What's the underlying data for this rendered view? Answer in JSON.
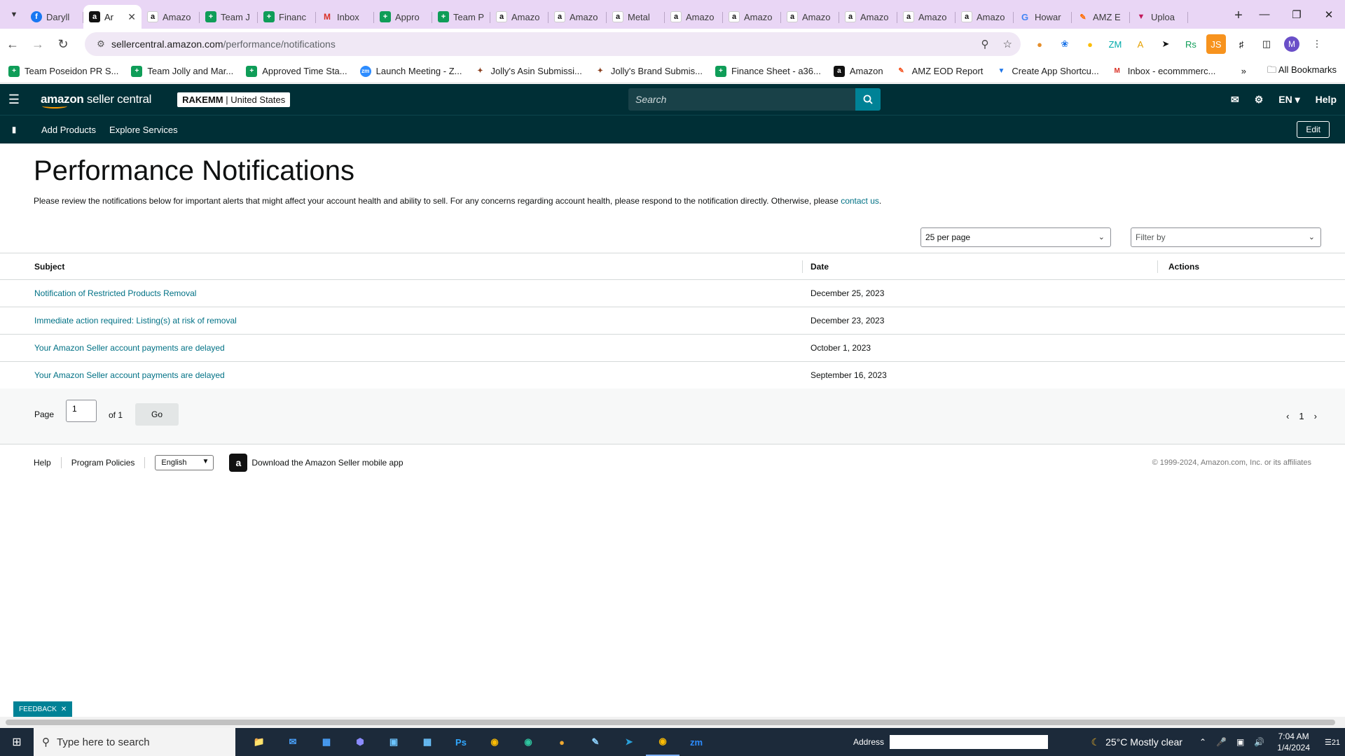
{
  "browser": {
    "tabs": [
      {
        "label": "Daryll",
        "icon": "facebook-icon"
      },
      {
        "label": "Ar",
        "icon": "amazon-icon",
        "active": true
      },
      {
        "label": "Amazo",
        "icon": "amazon-icon"
      },
      {
        "label": "Team J",
        "icon": "sheets-icon"
      },
      {
        "label": "Financ",
        "icon": "sheets-icon"
      },
      {
        "label": "Inbox",
        "icon": "gmail-icon"
      },
      {
        "label": "Appro",
        "icon": "sheets-icon"
      },
      {
        "label": "Team P",
        "icon": "sheets-icon"
      },
      {
        "label": "Amazo",
        "icon": "amazon-icon"
      },
      {
        "label": "Amazo",
        "icon": "amazon-icon"
      },
      {
        "label": "Metal",
        "icon": "amazon-icon"
      },
      {
        "label": "Amazo",
        "icon": "amazon-icon"
      },
      {
        "label": "Amazo",
        "icon": "amazon-icon"
      },
      {
        "label": "Amazo",
        "icon": "amazon-icon"
      },
      {
        "label": "Amazo",
        "icon": "amazon-icon"
      },
      {
        "label": "Amazo",
        "icon": "amazon-icon"
      },
      {
        "label": "Amazo",
        "icon": "amazon-icon"
      },
      {
        "label": "Howar",
        "icon": "google-icon"
      },
      {
        "label": "AMZ E",
        "icon": "amz-eod-icon"
      },
      {
        "label": "Uploa",
        "icon": "upload-icon"
      }
    ],
    "url_host": "sellercentral.amazon.com",
    "url_path": "/performance/notifications",
    "bookmarks": [
      {
        "label": "Team Poseidon PR S...",
        "icon": "sheets-icon"
      },
      {
        "label": "Team Jolly and Mar...",
        "icon": "sheets-icon"
      },
      {
        "label": "Approved Time Sta...",
        "icon": "sheets-icon"
      },
      {
        "label": "Launch Meeting - Z...",
        "icon": "zoom-icon"
      },
      {
        "label": "Jolly's Asin Submissi...",
        "icon": "jolly-icon"
      },
      {
        "label": "Jolly's Brand Submis...",
        "icon": "jolly-icon"
      },
      {
        "label": "Finance Sheet - a36...",
        "icon": "sheets-icon"
      },
      {
        "label": "Amazon",
        "icon": "amazon-icon"
      },
      {
        "label": "AMZ EOD Report",
        "icon": "amz-eod-icon"
      },
      {
        "label": "Create App Shortcu...",
        "icon": "shortcut-icon"
      },
      {
        "label": "Inbox - ecommmerc...",
        "icon": "gmail-icon"
      }
    ],
    "all_bookmarks": "All Bookmarks",
    "profile_initial": "M"
  },
  "header": {
    "logo_bold": "amazon",
    "logo_rest": " seller central",
    "store_name": "RAKEMM",
    "store_region": " | United States",
    "search_placeholder": "Search",
    "lang": "EN",
    "help": "Help"
  },
  "subnav": {
    "items": [
      "Add Products",
      "Explore Services"
    ],
    "edit": "Edit"
  },
  "main": {
    "title": "Performance Notifications",
    "description": "Please review the notifications below for important alerts that might affect your account health and ability to sell. For any concerns regarding account health, please respond to the notification directly. Otherwise, please ",
    "contact_link": "contact us",
    "description_end": ".",
    "per_page": "25 per page",
    "filter_by": "Filter by",
    "columns": {
      "subject": "Subject",
      "date": "Date",
      "actions": "Actions"
    },
    "rows": [
      {
        "subject": "Notification of Restricted Products Removal",
        "date": "December 25, 2023"
      },
      {
        "subject": "Immediate action required: Listing(s) at risk of removal",
        "date": "December 23, 2023"
      },
      {
        "subject": "Your Amazon Seller account payments are delayed",
        "date": "October 1, 2023"
      },
      {
        "subject": "Your Amazon Seller account payments are delayed",
        "date": "September 16, 2023"
      }
    ],
    "pager": {
      "page_label": "Page",
      "page_value": "1",
      "of_label": "of 1",
      "go": "Go",
      "current": "1"
    }
  },
  "footer": {
    "help": "Help",
    "policies": "Program Policies",
    "language": "English",
    "app_text": "Download the Amazon Seller mobile app",
    "copyright": "© 1999-2024, Amazon.com, Inc. or its affiliates"
  },
  "feedback": "FEEDBACK",
  "taskbar": {
    "search_placeholder": "Type here to search",
    "address_label": "Address",
    "weather": "25°C  Mostly clear",
    "time": "7:04 AM",
    "date": "1/4/2024",
    "notifications": "21"
  },
  "colors": {
    "header_bg": "#002f36",
    "link": "#007185",
    "accent": "#008296",
    "tabstrip": "#e9d6f5"
  }
}
